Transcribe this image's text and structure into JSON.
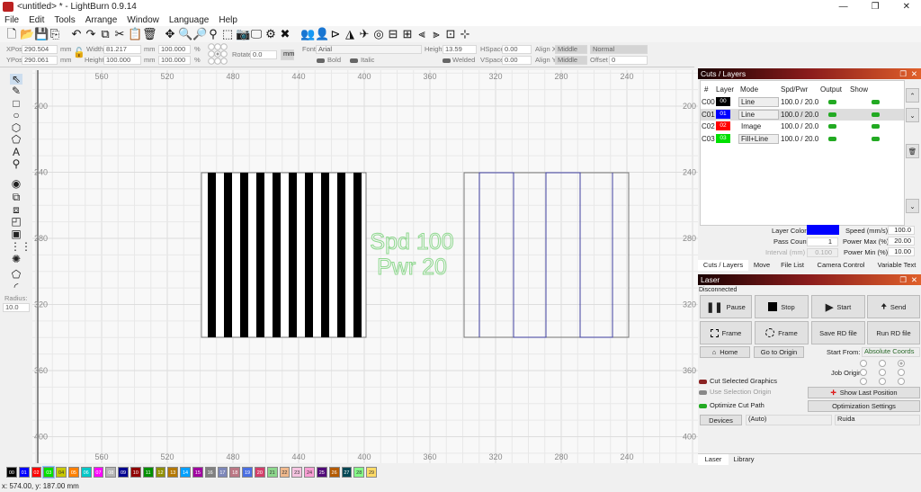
{
  "window": {
    "title": "<untitled> * - LightBurn 0.9.14",
    "controls": [
      "—",
      "❐",
      "✕"
    ]
  },
  "menu": [
    "File",
    "Edit",
    "Tools",
    "Arrange",
    "Window",
    "Language",
    "Help"
  ],
  "toolbar_icons": [
    {
      "name": "new-file",
      "g": "🗋"
    },
    {
      "name": "open-folder",
      "g": "📂"
    },
    {
      "name": "save",
      "g": "💾"
    },
    {
      "name": "import",
      "g": "⎘"
    },
    {
      "sep": true
    },
    {
      "name": "undo",
      "g": "↶"
    },
    {
      "name": "redo",
      "g": "↷"
    },
    {
      "name": "copy",
      "g": "⧉"
    },
    {
      "name": "cut",
      "g": "✂"
    },
    {
      "name": "paste",
      "g": "📋"
    },
    {
      "name": "delete",
      "g": "🗑"
    },
    {
      "sep": true
    },
    {
      "name": "move",
      "g": "✥"
    },
    {
      "name": "zoom-in",
      "g": "🔍"
    },
    {
      "name": "zoom-out",
      "g": "🔎"
    },
    {
      "name": "zoom-fit",
      "g": "⚲"
    },
    {
      "name": "zoom-selection",
      "g": "⬚"
    },
    {
      "name": "camera",
      "g": "📷"
    },
    {
      "name": "monitor",
      "g": "🖵"
    },
    {
      "name": "settings",
      "g": "⚙"
    },
    {
      "name": "tools",
      "g": "✖"
    },
    {
      "sep": true
    },
    {
      "name": "group",
      "g": "👥"
    },
    {
      "name": "user",
      "g": "👤"
    },
    {
      "name": "flip-h",
      "g": "⊳"
    },
    {
      "name": "mirror",
      "g": "◮"
    },
    {
      "name": "send",
      "g": "✈"
    },
    {
      "name": "target",
      "g": "◎"
    },
    {
      "name": "align-left",
      "g": "⊟"
    },
    {
      "name": "align-right",
      "g": "⊞"
    },
    {
      "name": "distribute-h",
      "g": "⫷"
    },
    {
      "name": "distribute-v",
      "g": "⫸"
    },
    {
      "name": "dock",
      "g": "⊡"
    },
    {
      "name": "center",
      "g": "⊹"
    }
  ],
  "props": {
    "xpos_label": "XPos",
    "xpos": "290.504",
    "ypos_label": "YPos",
    "ypos": "290.061",
    "mm": "mm",
    "width_label": "Width",
    "width": "81.217",
    "height_label": "Height",
    "height": "100.000",
    "scale_w": "100.000",
    "scale_h": "100.000",
    "pct": "%",
    "rotate_label": "Rotate",
    "rotate": "0.0",
    "unit_button": "mm",
    "font_label": "Font",
    "font": "Arial",
    "text_height_label": "Height",
    "text_height": "13.59",
    "hspace_label": "HSpace",
    "hspace": "0.00",
    "vspace_label": "VSpace",
    "vspace": "0.00",
    "alignx_label": "Align X",
    "alignx": "Middle",
    "aligny_label": "Align Y",
    "aligny": "Middle",
    "style": "Normal",
    "offset_label": "Offset",
    "offset": "0",
    "bold": "Bold",
    "italic": "Italic",
    "welded": "Welded"
  },
  "left_tools": [
    "select",
    "draw-lines",
    "rectangle",
    "ellipse",
    "polygon",
    "edit-nodes",
    "text",
    "position-laser",
    "offset",
    "weld",
    "union",
    "subtract",
    "intersect",
    "grid-array",
    "circular-array",
    "rounded",
    "corner"
  ],
  "radius": {
    "label": "Radius:",
    "value": "10.0"
  },
  "rulers": {
    "x": [
      "560",
      "520",
      "480",
      "440",
      "400",
      "360",
      "320",
      "280",
      "240"
    ],
    "y": [
      "200",
      "240",
      "280",
      "320",
      "360",
      "400"
    ]
  },
  "canvas_text": [
    "Spd 100",
    "Pwr 20"
  ],
  "canvas_colors": {
    "stripes": "#000000",
    "outline": "#4040a0",
    "text": "#8fd88f"
  },
  "cuts": {
    "title": "Cuts / Layers",
    "headers": [
      "#",
      "Layer",
      "Mode",
      "Spd/Pwr",
      "Output",
      "Show"
    ],
    "rows": [
      {
        "id": "C00",
        "layer": "00",
        "color": "#000000",
        "mode": "Line",
        "dropdown": true,
        "spd": "100.0 / 20.0"
      },
      {
        "id": "C01",
        "layer": "01",
        "color": "#0000ff",
        "mode": "Line",
        "dropdown": true,
        "spd": "100.0 / 20.0",
        "selected": true
      },
      {
        "id": "C02",
        "layer": "02",
        "color": "#ff0000",
        "mode": "Image",
        "dropdown": false,
        "spd": "100.0 / 20.0"
      },
      {
        "id": "C03",
        "layer": "03",
        "color": "#00e000",
        "mode": "Fill+Line",
        "dropdown": true,
        "spd": "100.0 / 20.0"
      }
    ],
    "layer_color_label": "Layer Color",
    "layer_color": "#0000ff",
    "pass_count_label": "Pass Count",
    "pass_count": "1",
    "interval_label": "Interval (mm)",
    "interval": "0.100",
    "speed_label": "Speed (mm/s)",
    "speed": "100.0",
    "pmax_label": "Power Max (%)",
    "pmax": "20.00",
    "pmin_label": "Power Min (%)",
    "pmin": "10.00"
  },
  "tabs_top": [
    "Cuts / Layers",
    "Move",
    "File List",
    "Camera Control",
    "Variable Text"
  ],
  "laser": {
    "title": "Laser",
    "status": "Disconnected",
    "pause": "Pause",
    "stop": "Stop",
    "start": "Start",
    "send": "Send",
    "frame1": "Frame",
    "frame2": "Frame",
    "save_rd": "Save RD file",
    "run_rd": "Run RD file",
    "home": "Home",
    "go_origin": "Go to Origin",
    "start_from_label": "Start From:",
    "start_from": "Absolute Coords",
    "job_origin_label": "Job Origin",
    "cut_selected": "Cut Selected Graphics",
    "use_sel_origin": "Use Selection Origin",
    "optimize": "Optimize Cut Path",
    "show_last": "Show Last Position",
    "opt_settings": "Optimization Settings",
    "devices": "Devices",
    "device": "(Auto)",
    "controller": "Ruida"
  },
  "tabs_bottom": [
    "Laser",
    "Library"
  ],
  "palette": [
    [
      "00",
      "#000000"
    ],
    [
      "01",
      "#0000ff"
    ],
    [
      "02",
      "#ff0000"
    ],
    [
      "03",
      "#00e000"
    ],
    [
      "04",
      "#c8c800"
    ],
    [
      "05",
      "#ff8000"
    ],
    [
      "06",
      "#00c8c8"
    ],
    [
      "07",
      "#ff00ff"
    ],
    [
      "08",
      "#b4b4b4"
    ],
    [
      "09",
      "#000090"
    ],
    [
      "10",
      "#900000"
    ],
    [
      "11",
      "#009000"
    ],
    [
      "12",
      "#909000"
    ],
    [
      "13",
      "#b47800"
    ],
    [
      "14",
      "#00a0ff"
    ],
    [
      "15",
      "#a000a0"
    ],
    [
      "16",
      "#808080"
    ],
    [
      "17",
      "#7d87b9"
    ],
    [
      "18",
      "#bb7784"
    ],
    [
      "19",
      "#4a6fe3"
    ],
    [
      "20",
      "#d33f6a"
    ],
    [
      "21",
      "#8cd78c"
    ],
    [
      "22",
      "#f0b98d"
    ],
    [
      "23",
      "#f6c4e1"
    ],
    [
      "24",
      "#fa9ed4"
    ],
    [
      "25",
      "#500a78"
    ],
    [
      "26",
      "#b45a00"
    ],
    [
      "27",
      "#004754"
    ],
    [
      "28",
      "#86fa88"
    ],
    [
      "29",
      "#ffdb66"
    ]
  ],
  "status": "x: 574.00, y: 187.00 mm"
}
